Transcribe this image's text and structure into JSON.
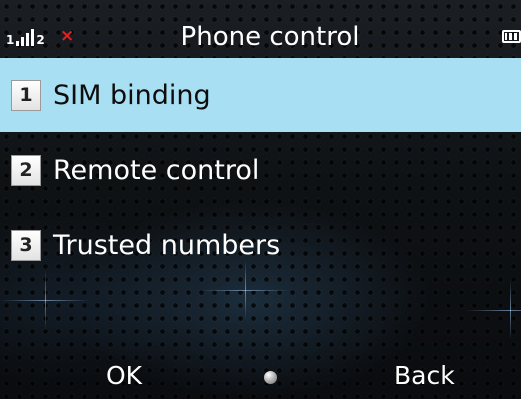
{
  "status_bar": {
    "signal_icon": "signal-strength-icon",
    "sim_slot_label": "1",
    "second_sim_label": "2",
    "no_sim_icon": "no-sim-x-icon",
    "no_sim_glyph": "×",
    "battery_icon": "battery-icon"
  },
  "header": {
    "title": "Phone control"
  },
  "menu": {
    "items": [
      {
        "number": "1",
        "label": "SIM binding",
        "selected": true
      },
      {
        "number": "2",
        "label": "Remote control",
        "selected": false
      },
      {
        "number": "3",
        "label": "Trusted numbers",
        "selected": false
      }
    ]
  },
  "softkeys": {
    "left_label": "OK",
    "center_icon": "center-select-dot-icon",
    "right_label": "Back"
  },
  "colors": {
    "selection_highlight": "#a8dff2",
    "no_sim_red": "#e32222",
    "text": "#ffffff"
  }
}
